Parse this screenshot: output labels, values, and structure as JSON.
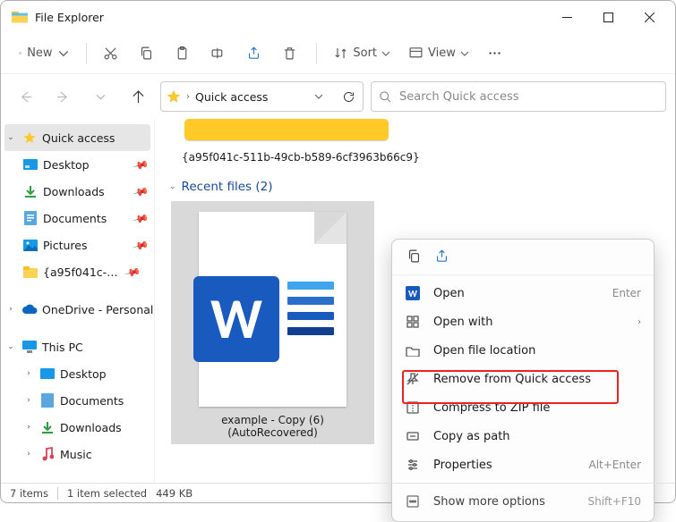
{
  "title": "File Explorer",
  "toolbar": {
    "new": "New",
    "sort": "Sort",
    "view": "View"
  },
  "address": {
    "label": "Quick access"
  },
  "search": {
    "placeholder": "Search Quick access"
  },
  "sidebar": {
    "quick_access": "Quick access",
    "items": [
      {
        "label": "Desktop"
      },
      {
        "label": "Downloads"
      },
      {
        "label": "Documents"
      },
      {
        "label": "Pictures"
      },
      {
        "label": "{a95f041c-511b-49cb-b589-6cf3963b66c9}"
      }
    ],
    "onedrive": "OneDrive - Personal",
    "this_pc": "This PC",
    "pc_items": [
      {
        "label": "Desktop"
      },
      {
        "label": "Documents"
      },
      {
        "label": "Downloads"
      },
      {
        "label": "Music"
      }
    ]
  },
  "content": {
    "guid": "{a95f041c-511b-49cb-b589-6cf3963b66c9}",
    "recent_label": "Recent files (2)",
    "file_label": "example - Copy (6) (AutoRecovered)"
  },
  "ctx": {
    "open": "Open",
    "open_hint": "Enter",
    "open_with": "Open with",
    "open_loc": "Open file location",
    "remove": "Remove from Quick access",
    "compress": "Compress to ZIP file",
    "copy_path": "Copy as path",
    "properties": "Properties",
    "properties_hint": "Alt+Enter",
    "more": "Show more options",
    "more_hint": "Shift+F10"
  },
  "status": {
    "items": "7 items",
    "selected": "1 item selected",
    "size": "449 KB"
  }
}
